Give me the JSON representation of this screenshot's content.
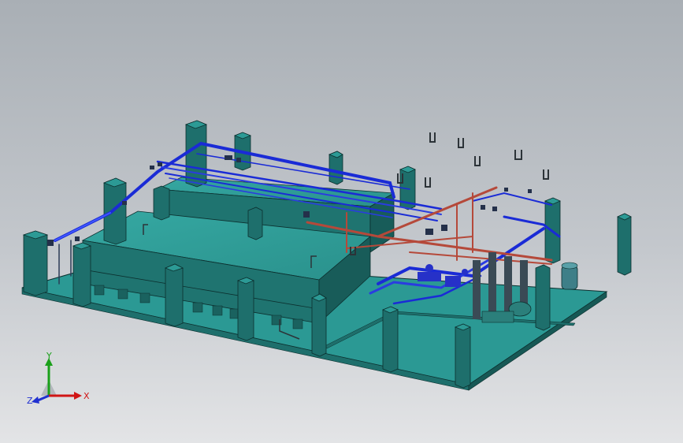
{
  "viewport": {
    "background_top": "#a9afb5",
    "background_bottom": "#e3e4e6"
  },
  "colors": {
    "concrete_top": "#2c9a95",
    "concrete_side": "#1e6f6c",
    "concrete_dark": "#164f4d",
    "edge": "#0c2f2e",
    "pipe_blue": "#1a2bd6",
    "pipe_blue_light": "#3f56ff",
    "pipe_red": "#b5493a",
    "equipment_dark": "#3a4a55"
  },
  "triad": {
    "labels": {
      "x": "X",
      "y": "Y",
      "z": "Z"
    },
    "colors": {
      "x": "#d01515",
      "y": "#1aa01a",
      "z": "#2030d0"
    },
    "icon": "coordinate-triad-icon"
  }
}
